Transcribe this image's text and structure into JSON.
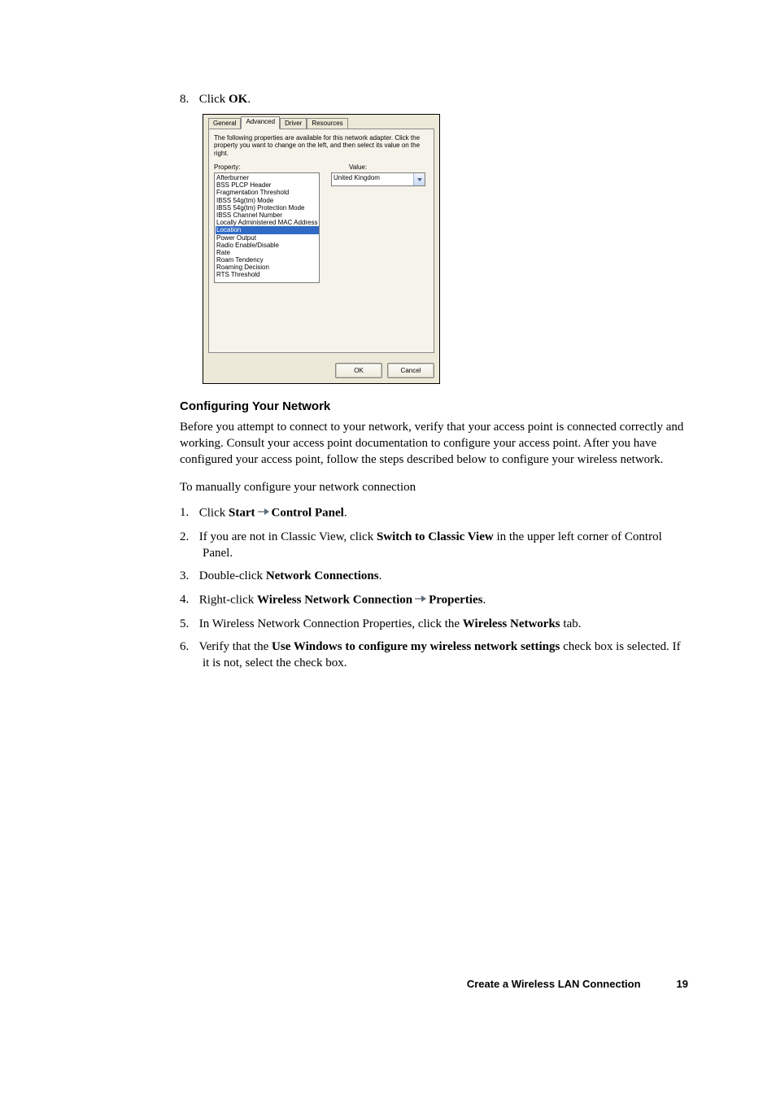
{
  "step8": {
    "num": "8.",
    "pre": "Click ",
    "bold": "OK",
    "post": "."
  },
  "dialog": {
    "tabs": [
      "General",
      "Advanced",
      "Driver",
      "Resources"
    ],
    "active_tab": 1,
    "description": "The following properties are available for this network adapter. Click the property you want to change on the left, and then select its value on the right.",
    "property_label": "Property:",
    "value_label": "Value:",
    "properties": [
      "Afterburner",
      "BSS PLCP Header",
      "Fragmentation Threshold",
      "IBSS 54g(tm) Mode",
      "IBSS 54g(tm) Protection Mode",
      "IBSS Channel Number",
      "Locally Administered MAC Address",
      "Location",
      "Power Output",
      "Radio Enable/Disable",
      "Rate",
      "Roam Tendency",
      "Roaming Decision",
      "RTS Threshold"
    ],
    "selected_property_index": 7,
    "value_selected": "United Kingdom",
    "buttons": {
      "ok": "OK",
      "cancel": "Cancel"
    }
  },
  "section": {
    "heading": "Configuring Your Network",
    "intro": "Before you attempt to connect to your network, verify that your access point is connected correctly and working. Consult your access point documentation to configure your access point. After you have configured your access point, follow the steps described below to configure your wireless network.",
    "lead": "To manually configure your network connection",
    "steps": {
      "s1_pre": "Click ",
      "s1_b1": "Start",
      "s1_b2": "Control Panel",
      "s1_post": ".",
      "s2_pre": "If you are not in Classic View, click ",
      "s2_b": "Switch to Classic View",
      "s2_post": " in the upper left corner of Control Panel.",
      "s3_pre": "Double-click ",
      "s3_b": "Network Connections",
      "s3_post": ".",
      "s4_pre": "Right-click ",
      "s4_b1": "Wireless Network Connection",
      "s4_b2": "Properties",
      "s4_post": ".",
      "s5_pre": "In Wireless Network Connection Properties, click the ",
      "s5_b": "Wireless Networks",
      "s5_post": " tab.",
      "s6_pre": "Verify that the ",
      "s6_b": "Use Windows to configure my wireless network settings",
      "s6_post": " check box is selected. If it is not, select the check box."
    }
  },
  "footer": {
    "title": "Create a Wireless LAN Connection",
    "page": "19"
  }
}
